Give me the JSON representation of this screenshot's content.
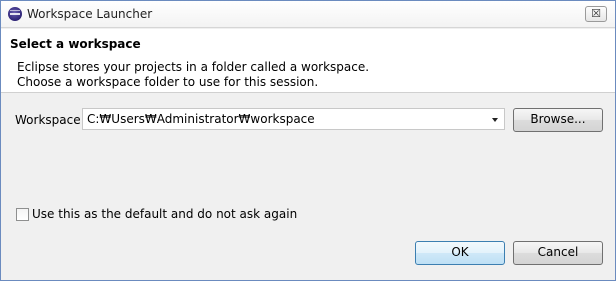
{
  "window": {
    "title": "Workspace Launcher",
    "close_glyph": "☒"
  },
  "header": {
    "title": "Select a workspace",
    "description_line1": "Eclipse stores your projects in a folder called a workspace.",
    "description_line2": "Choose a workspace folder to use for this session."
  },
  "workspace": {
    "label": "Workspace:",
    "value": "C:₩Users₩Administrator₩workspace",
    "browse_label": "Browse..."
  },
  "default_option": {
    "label": "Use this as the default and do not ask again",
    "checked": false
  },
  "buttons": {
    "ok_label": "OK",
    "cancel_label": "Cancel"
  },
  "colors": {
    "accent": "#3c7fb1",
    "border": "#6b8bbf"
  },
  "icons": {
    "app": "eclipse-icon",
    "close": "close-icon",
    "dropdown": "chevron-down-icon"
  }
}
